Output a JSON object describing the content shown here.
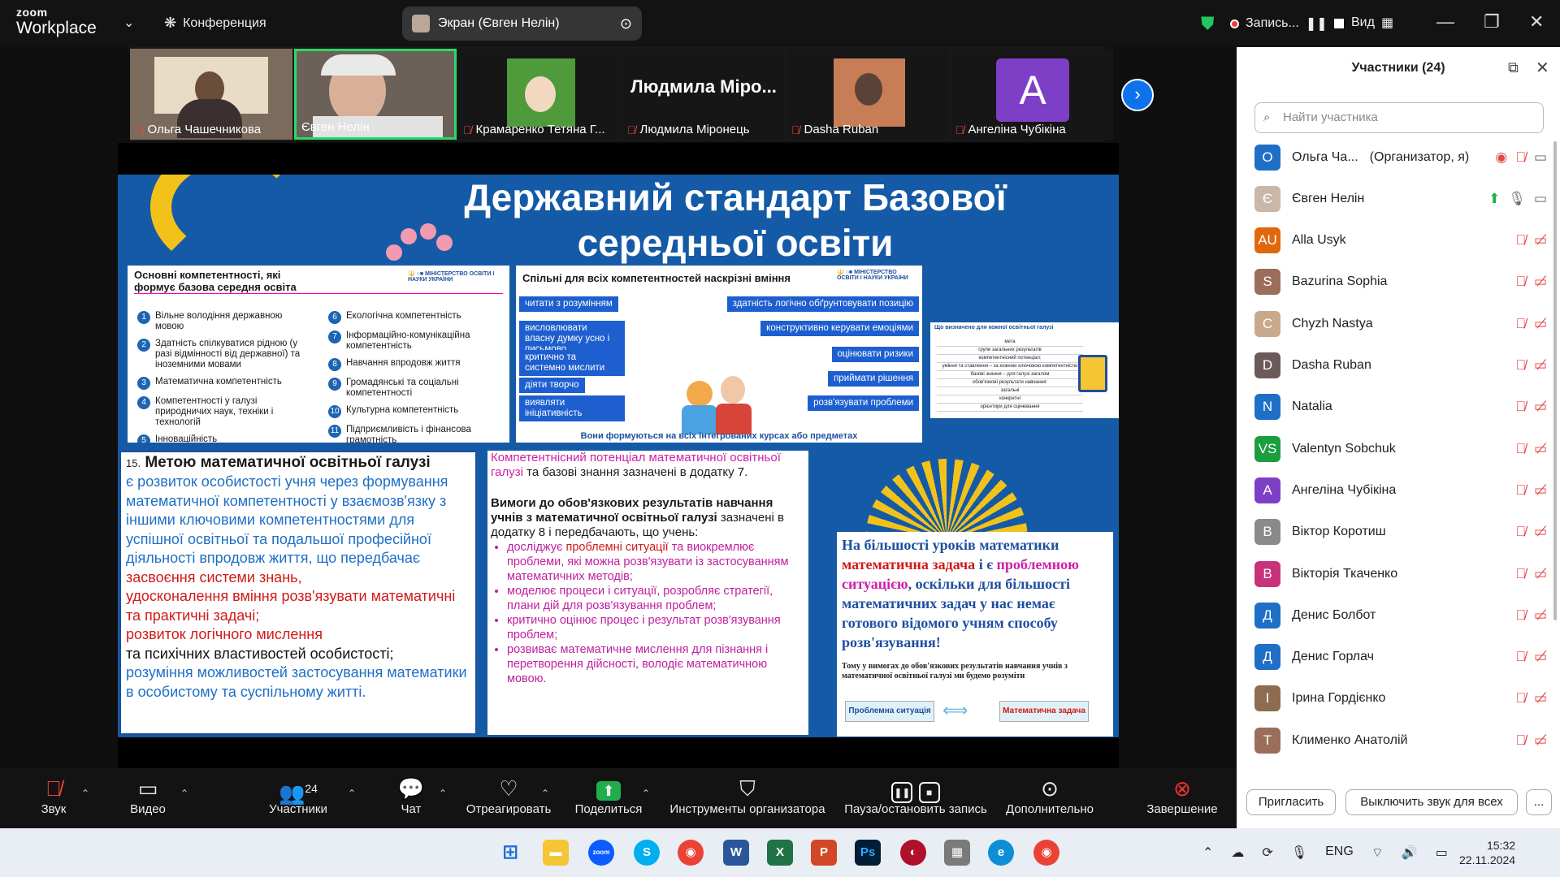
{
  "app": {
    "brand_top": "zoom",
    "brand_bottom": "Workplace",
    "conference": "Конференция",
    "screen_label": "Экран (Євген Нелін)",
    "record_label": "Запись...",
    "view_label": "Вид"
  },
  "thumbnails": [
    {
      "name": "Ольга Чашечникова",
      "muted": true
    },
    {
      "name": "Євген Нелін",
      "muted": false,
      "active": true
    },
    {
      "name": "Крамаренко Тетяна Г...",
      "muted": true
    },
    {
      "name": "Людмила Міронець",
      "muted": true,
      "big_name": "Людмила Міро..."
    },
    {
      "name": "Dasha Ruban",
      "muted": true
    },
    {
      "name": "Ангеліна Чубікіна",
      "muted": true,
      "letter": "A"
    }
  ],
  "slide": {
    "title_line1": "Державний стандарт Базової",
    "title_line2": "середньої освіти",
    "comp_head": "Основні компетентності, які формує базова середня освіта",
    "ministry": "МІНІСТЕРСТВО ОСВІТИ І НАУКИ УКРАЇНИ",
    "comp_left": [
      {
        "n": "1",
        "t": "Вільне володіння державною мовою"
      },
      {
        "n": "2",
        "t": "Здатність спілкуватися рідною (у разі відмінності від державної) та іноземними мовами"
      },
      {
        "n": "3",
        "t": "Математична компетентність"
      },
      {
        "n": "4",
        "t": "Компетентності у галузі природничих наук, техніки і технологій"
      },
      {
        "n": "5",
        "t": "Інноваційність"
      }
    ],
    "comp_right": [
      {
        "n": "6",
        "t": "Екологічна компетентність"
      },
      {
        "n": "7",
        "t": "Інформаційно-комунікаційна компетентність"
      },
      {
        "n": "8",
        "t": "Навчання впродовж життя"
      },
      {
        "n": "9",
        "t": "Громадянські та соціальні компетентності"
      },
      {
        "n": "10",
        "t": "Культурна компетентність"
      },
      {
        "n": "11",
        "t": "Підприємливість і фінансова грамотність"
      }
    ],
    "skills_head": "Спільні для всіх компетентностей наскрізні вміння",
    "skills_left": [
      "читати з розумінням",
      "висловлювати власну думку усно і письмово",
      "критично та системно мислити",
      "діяти творчо",
      "виявляти ініціативність"
    ],
    "skills_right": [
      "здатність логічно обґрунтовувати позицію",
      "конструктивно керувати емоціями",
      "оцінювати ризики",
      "приймати рішення",
      "розв'язувати проблеми"
    ],
    "skills_foot": "Вони формуються на всіх інтегрованих курсах або предметах",
    "small_head": "Що визначено для кожної освітньої галузі",
    "small_lines": [
      "мета",
      "групи загальних результатів",
      "компетентнісний потенціал:",
      "уміння та ставлення – за кожною ключовою компетентністю",
      "базові знання – для галузі загалом",
      "обов'язкові результати навчання:",
      "загальні",
      "конкретні",
      "орієнтири для оцінювання"
    ],
    "goal_num": "15.",
    "goal_head": "Метою математичної освітньої галузі",
    "goal_p1": "є розвиток особистості учня через формування математичної компетентності у взаємозв'язку з іншими ключовими компетентностями для успішної освітньої та подальшої професійної діяльності впродовж життя, що передбачає",
    "goal_r1": "засвоєння системи знань,",
    "goal_r2": " удосконалення вміння розв'язувати математичні та практичні задачі;",
    "goal_r3": "розвиток логічного мислення",
    "goal_b1": "та психічних властивостей особистості;",
    "goal_p2": "розуміння можливостей застосування математики в особистому та суспільному житті.",
    "mid_pink1": "Компетентнісний потенціал математичної освітньої галузі",
    "mid_t1": " та базові знання зазначені в додатку 7.",
    "mid_head": "Вимоги до обов'язкових результатів навчання учнів з математичної освітньої галузі",
    "mid_t2": " зазначені в додатку 8 і передбачають, що учень:",
    "mid_bullets": [
      {
        "pre": "досліджує ",
        "red": "проблемні ситуації",
        "post": " та виокремлює проблеми, які можна розв'язувати із застосуванням математичних методів;"
      },
      {
        "pre": "моделює процеси і ситуації, розробляє стратегії, плани дій для розв'язування проблем;",
        "red": "",
        "post": ""
      },
      {
        "pre": "критично оцінює процес і результат розв'язування проблем;",
        "red": "",
        "post": ""
      },
      {
        "pre": "розвиває математичне мислення для пізнання і перетворення дійсності, володіє математичною мовою.",
        "red": "",
        "post": ""
      }
    ],
    "right_t1": "На більшості уроків математики ",
    "right_r1": "математична задача",
    "right_t2": " і є ",
    "right_p1": "проблемною ситуацією",
    "right_t3": ", оскільки для більшості математичних задач у нас немає готового відомого учням способу розв'язування!",
    "right_small": "Тому у вимогах до обов'язкових результатів навчання учнів з математичної освітньої галузі ми будемо розуміти",
    "right_box1": "Проблемна ситуація",
    "right_box2": "Математична задача"
  },
  "panel": {
    "title": "Участники (24)",
    "search_placeholder": "Найти участника",
    "participants": [
      {
        "name": "Ольга Ча...",
        "role": "(Организатор, я)",
        "initials": "О",
        "color": "#1f6fc6"
      },
      {
        "name": "Євген Нелін",
        "role": "",
        "initials": "Є",
        "color": "#c9b8a8"
      },
      {
        "name": "Alla Usyk",
        "role": "",
        "initials": "AU",
        "color": "#e0680c"
      },
      {
        "name": "Bazurina Sophia",
        "role": "",
        "initials": "S",
        "color": "#9b6d5b"
      },
      {
        "name": "Chyzh Nastya",
        "role": "",
        "initials": "C",
        "color": "#c9a88b"
      },
      {
        "name": "Dasha Ruban",
        "role": "",
        "initials": "D",
        "color": "#6b5a5a"
      },
      {
        "name": "Natalia",
        "role": "",
        "initials": "N",
        "color": "#1f6fc6"
      },
      {
        "name": "Valentyn Sobchuk",
        "role": "",
        "initials": "VS",
        "color": "#1b9e3e"
      },
      {
        "name": "Ангеліна Чубікіна",
        "role": "",
        "initials": "A",
        "color": "#7e3fc7"
      },
      {
        "name": "Віктор Коротиш",
        "role": "",
        "initials": "В",
        "color": "#8a8a8a"
      },
      {
        "name": "Вікторія Ткаченко",
        "role": "",
        "initials": "В",
        "color": "#c8327a"
      },
      {
        "name": "Денис Болбот",
        "role": "",
        "initials": "Д",
        "color": "#1f6fc6"
      },
      {
        "name": "Денис Горлач",
        "role": "",
        "initials": "Д",
        "color": "#1f6fc6"
      },
      {
        "name": "Ірина Гордієнко",
        "role": "",
        "initials": "І",
        "color": "#8d6c52"
      },
      {
        "name": "Клименко Анатолій",
        "role": "",
        "initials": "Т",
        "color": "#9b6d5b"
      }
    ],
    "invite": "Пригласить",
    "mute_all": "Выключить звук для всех",
    "more": "..."
  },
  "toolbar": {
    "audio": "Звук",
    "video": "Видео",
    "participants": "Участники",
    "participants_count": "24",
    "chat": "Чат",
    "react": "Отреагировать",
    "share": "Поделиться",
    "host_tools": "Инструменты организатора",
    "pause_record": "Пауза/остановить запись",
    "more": "Дополнительно",
    "end": "Завершение"
  },
  "taskbar": {
    "lang": "ENG",
    "time": "15:32",
    "date": "22.11.2024"
  }
}
